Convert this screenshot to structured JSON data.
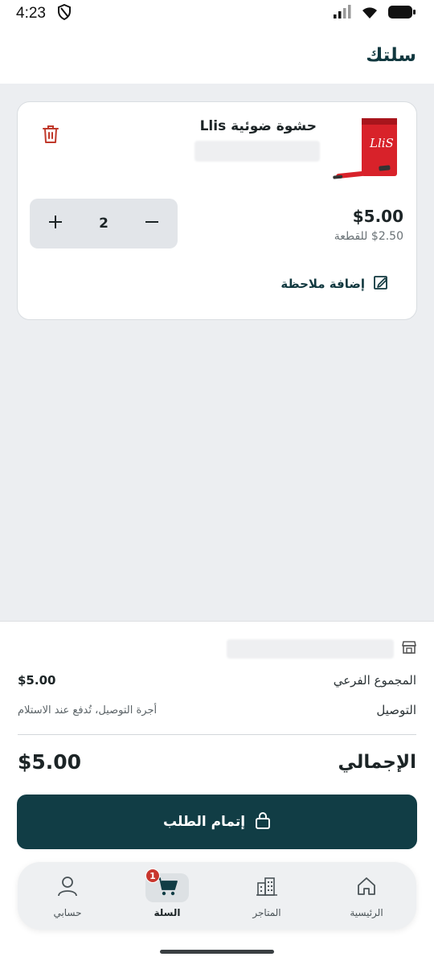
{
  "status_bar": {
    "time": "4:23"
  },
  "header": {
    "title": "سلتك"
  },
  "cart": {
    "items": [
      {
        "name": "حشوة ضوئية Llis",
        "thumbnail_text": "LliS",
        "quantity": "2",
        "price_total": "$5.00",
        "price_unit": "$2.50 للقطعة",
        "add_note_label": "إضافة ملاحظة"
      }
    ]
  },
  "summary": {
    "subtotal_label": "المجموع الفرعي",
    "subtotal_value": "$5.00",
    "delivery_label": "التوصيل",
    "delivery_value": "أجرة التوصيل، تُدفع عند الاستلام",
    "total_label": "الإجمالي",
    "total_value": "$5.00",
    "checkout_label": "إتمام الطلب"
  },
  "bottom_nav": {
    "items": [
      {
        "label": "الرئيسية",
        "icon": "home-icon"
      },
      {
        "label": "المتاجر",
        "icon": "stores-icon"
      },
      {
        "label": "السلة",
        "icon": "cart-icon",
        "badge": "1",
        "active": true
      },
      {
        "label": "حسابي",
        "icon": "user-icon"
      }
    ]
  },
  "colors": {
    "brand": "#113d45",
    "background_gray": "#eceef1",
    "delete_red": "#c0392b",
    "badge_red": "#c8362e"
  }
}
